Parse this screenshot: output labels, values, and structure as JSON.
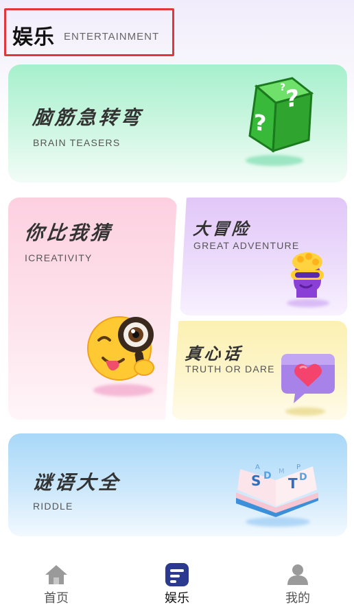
{
  "header": {
    "title": "娱乐",
    "subtitle": "ENTERTAINMENT"
  },
  "cards": {
    "brain_teasers": {
      "title": "脑筋急转弯",
      "subtitle": "BRAIN TEASERS"
    },
    "guess": {
      "title": "你比我猜",
      "subtitle": "ICREATIVITY"
    },
    "adventure": {
      "title": "大冒险",
      "subtitle": "GREAT ADVENTURE"
    },
    "truth": {
      "title": "真心话",
      "subtitle": "TRUTH OR DARE"
    },
    "riddle": {
      "title": "谜语大全",
      "subtitle": "RIDDLE"
    }
  },
  "tabbar": {
    "items": [
      {
        "label": "首页",
        "icon": "home-icon",
        "active": false
      },
      {
        "label": "娱乐",
        "icon": "entertainment-icon",
        "active": true
      },
      {
        "label": "我的",
        "icon": "profile-icon",
        "active": false
      }
    ]
  },
  "colors": {
    "highlight_border": "#e2373a",
    "tab_active": "#2b3990",
    "tab_inactive": "#9a9a9a"
  }
}
